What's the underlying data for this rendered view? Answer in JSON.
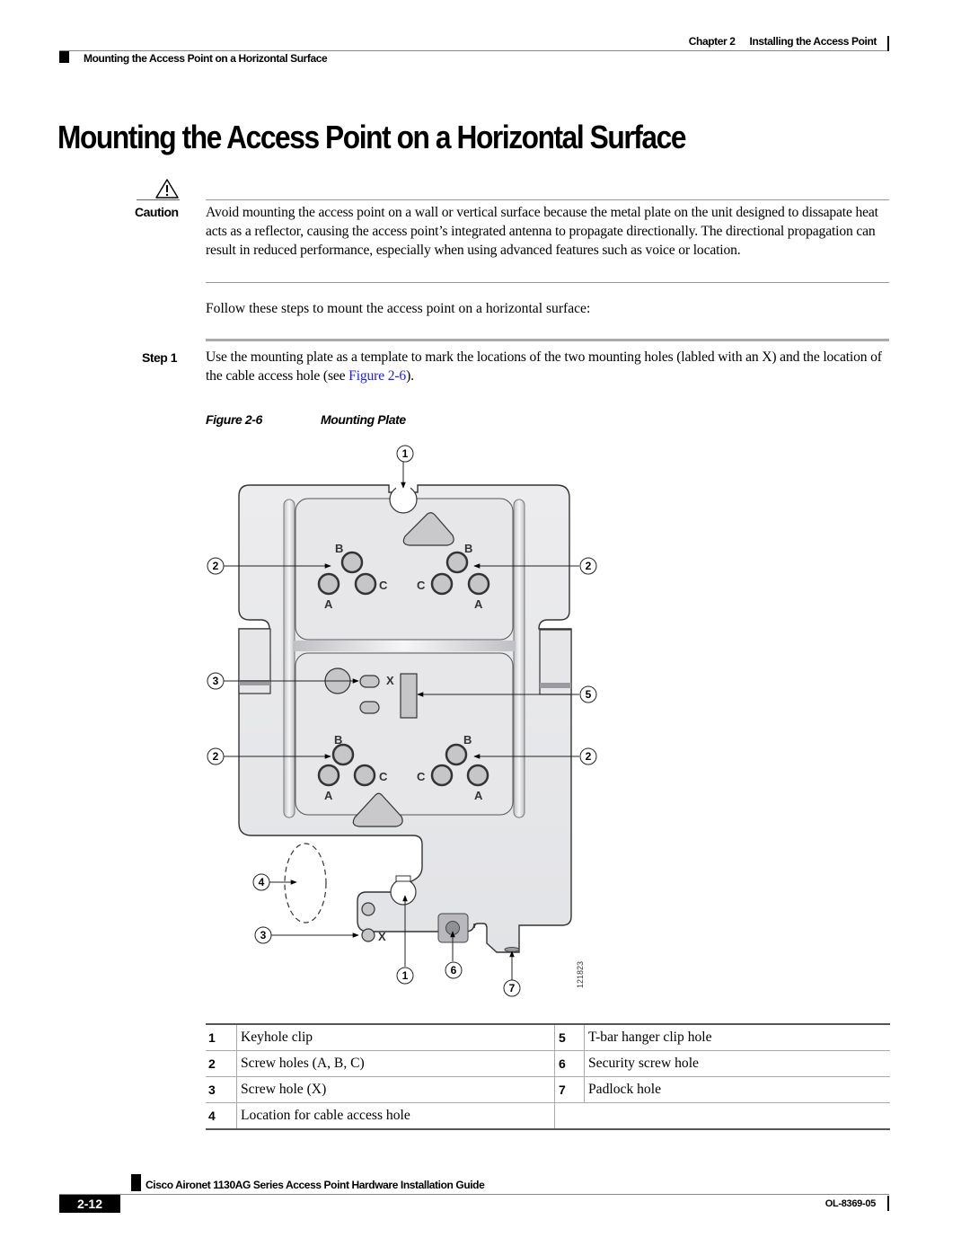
{
  "header": {
    "chapter_label": "Chapter 2",
    "chapter_title": "Installing the Access Point",
    "section": "Mounting the Access Point on a Horizontal Surface"
  },
  "page_title": "Mounting the Access Point on a Horizontal Surface",
  "caution": {
    "icon": "warning-triangle-icon",
    "label": "Caution",
    "text": "Avoid mounting the access point on a wall or vertical surface because the metal plate on the unit designed to dissapate heat acts as a reflector, causing the access point’s integrated antenna to propagate directionally. The directional propagation can result in reduced performance, especially when using advanced features such as voice or location."
  },
  "intro": "Follow these steps to mount the access point on a horizontal surface:",
  "steps": [
    {
      "label": "Step 1",
      "text_before": "Use the mounting plate as a template to mark the locations of the two mounting holes (labled with an X) and the location of the cable access hole (see ",
      "link": "Figure 2-6",
      "text_after": ")."
    }
  ],
  "figure": {
    "number": "Figure 2-6",
    "title": "Mounting Plate",
    "art_id": "121823",
    "callouts": [
      "1",
      "2",
      "2",
      "3",
      "5",
      "2",
      "2",
      "4",
      "3",
      "1",
      "6",
      "7"
    ],
    "hole_labels": {
      "a": "A",
      "b": "B",
      "c": "C",
      "x": "X"
    }
  },
  "legend": [
    {
      "num": "1",
      "desc": "Keyhole clip",
      "num2": "5",
      "desc2": "T-bar hanger clip hole"
    },
    {
      "num": "2",
      "desc": "Screw holes (A, B, C)",
      "num2": "6",
      "desc2": "Security screw hole"
    },
    {
      "num": "3",
      "desc": "Screw hole (X)",
      "num2": "7",
      "desc2": "Padlock hole"
    },
    {
      "num": "4",
      "desc": "Location for cable access hole",
      "num2": "",
      "desc2": ""
    }
  ],
  "footer": {
    "guide_title": "Cisco Aironet 1130AG Series Access Point Hardware Installation Guide",
    "page_number": "2-12",
    "doc_number": "OL-8369-05"
  }
}
